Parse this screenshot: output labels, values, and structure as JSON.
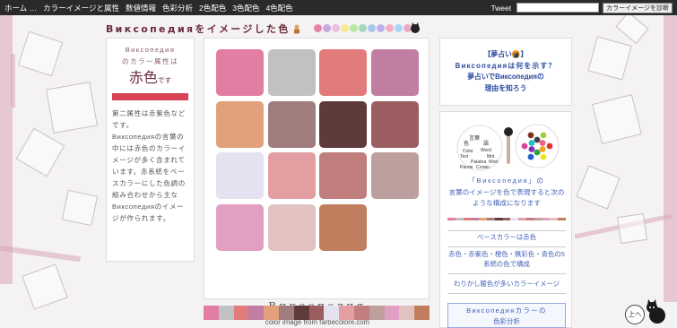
{
  "nav": {
    "items": [
      "ホーム …",
      "カラーイメージと属性",
      "数値情報",
      "色彩分析",
      "2色配色",
      "3色配色",
      "4色配色"
    ],
    "tweet": "Tweet",
    "search_value": "",
    "diagnose_label": "カラーイメージを診断"
  },
  "page": {
    "title": "Викcопедияをイメージした色",
    "title_dots": [
      "#e880a8",
      "#c8a8e0",
      "#e8c0e0",
      "#f8e890",
      "#b8e8a0",
      "#a0d8c0",
      "#a8c8f0",
      "#c0b0f0",
      "#f0b0c8",
      "#a8d8f8",
      "#e8a8c8"
    ]
  },
  "left": {
    "line1": "Викcопедия",
    "line2": "のカラー属性は",
    "attr": "赤色",
    "attr_suffix": "です",
    "bar_color": "#d94155",
    "text1": "第二属性は赤紫色などです。",
    "text2": "Викcопедияの言葉の中には赤色のカラーイメージが多く含まれています。赤系統をベースカラーにした色調の組み合わせから主な",
    "text3": "Викcопедияのイメージが作られます。"
  },
  "palette": {
    "swatches": [
      "#e27da3",
      "#c1c1c1",
      "#e27b7b",
      "#c07ea3",
      "#e3a07d",
      "#a17c7c",
      "#5e3a3b",
      "#9c5d60",
      "#e4e1f1",
      "#e39ea2",
      "#c07e7f",
      "#bda09e",
      "#e1a0c3",
      "#e1c2c1",
      "#c17e5f"
    ],
    "name": "Викcопедия",
    "credit": "color image from farbecolore.com"
  },
  "strip": {
    "colors": [
      "#e27da3",
      "#c1c1c1",
      "#e27b7b",
      "#c07ea3",
      "#e3a07d",
      "#a17c7c",
      "#5e3a3b",
      "#9c5d60",
      "#e4e1f1",
      "#e39ea2",
      "#c07e7f",
      "#bda09e",
      "#e1a0c3",
      "#e1c2c1",
      "#c17e5f"
    ]
  },
  "right": {
    "top_line1": "【夢占い🍘】",
    "top_line2": "Викcопедияは何を示す？",
    "top_line3": "夢占いでВикcопедияの",
    "top_line4": "理由を知ろう",
    "logo_words": [
      "言葉",
      "語",
      "Word",
      "Mot",
      "Wort",
      "Text",
      "Palabra",
      "Parole",
      "Слово",
      "色",
      "Color"
    ],
    "desc_name": "「Викcопедия」の",
    "desc_rest": "言葉のイメージを色で表現すると次のような構成になります",
    "base_color": "ベースカラーは赤色",
    "composition": "赤色・赤紫色・橙色・無彩色・青色の5系統の色で構成",
    "note": "わりかし暖色が多いカラーイメージ",
    "analysis_name": "Викcопедияカラーの",
    "analysis_rest": "色彩分析"
  },
  "top_button": {
    "label": "上へ"
  }
}
